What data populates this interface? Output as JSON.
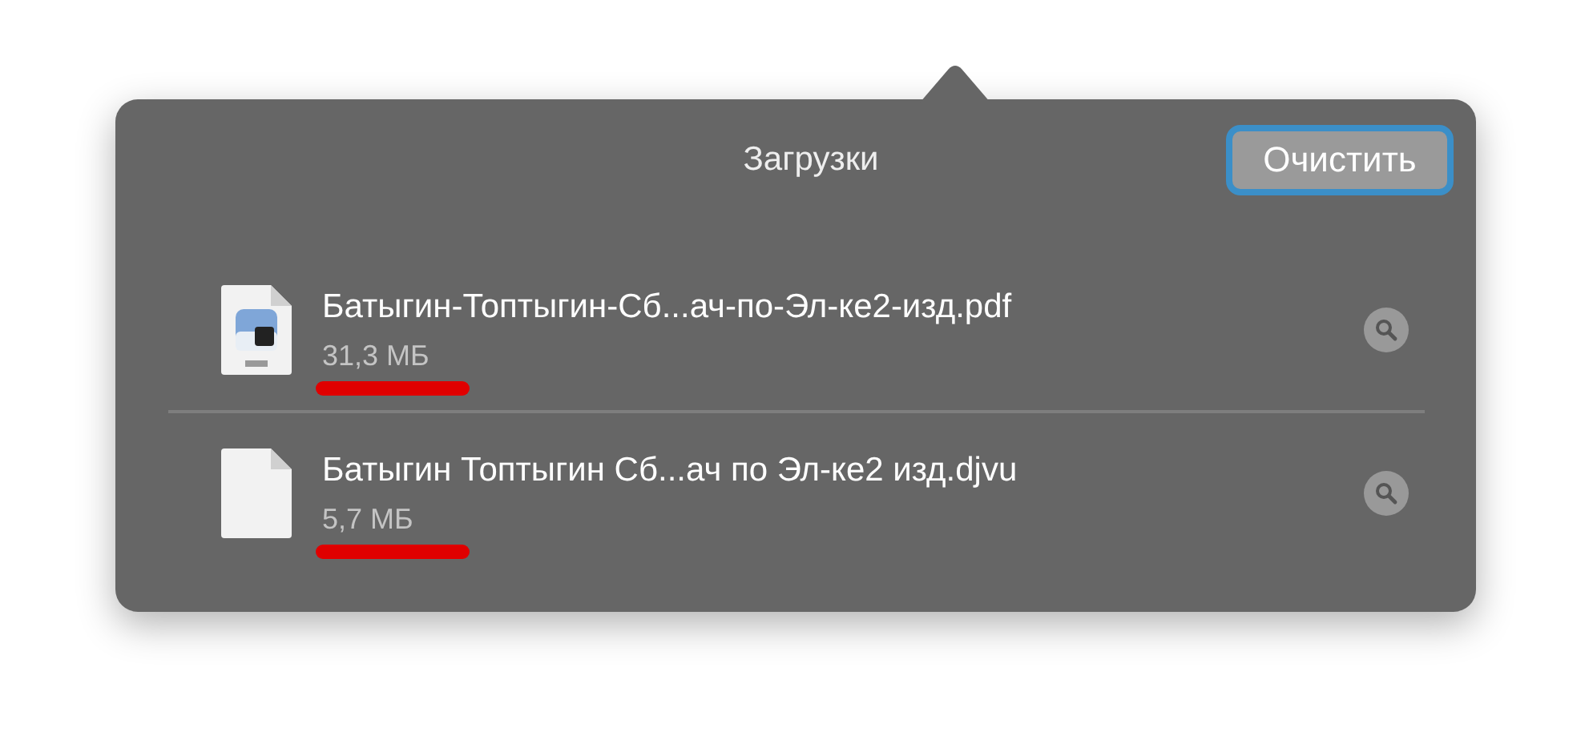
{
  "popover": {
    "title": "Загрузки",
    "clear_button": {
      "label": "Очистить",
      "focused": true
    }
  },
  "downloads": [
    {
      "kind": "pdf",
      "name": "Батыгин-Топтыгин-Сб...ач-по-Эл-ке2-изд.pdf",
      "size": "31,3 МБ",
      "underlined": true
    },
    {
      "kind": "document",
      "name": "Батыгин Топтыгин Сб...ач по Эл-ке2 изд.djvu",
      "size": "5,7 МБ",
      "underlined": true
    }
  ]
}
